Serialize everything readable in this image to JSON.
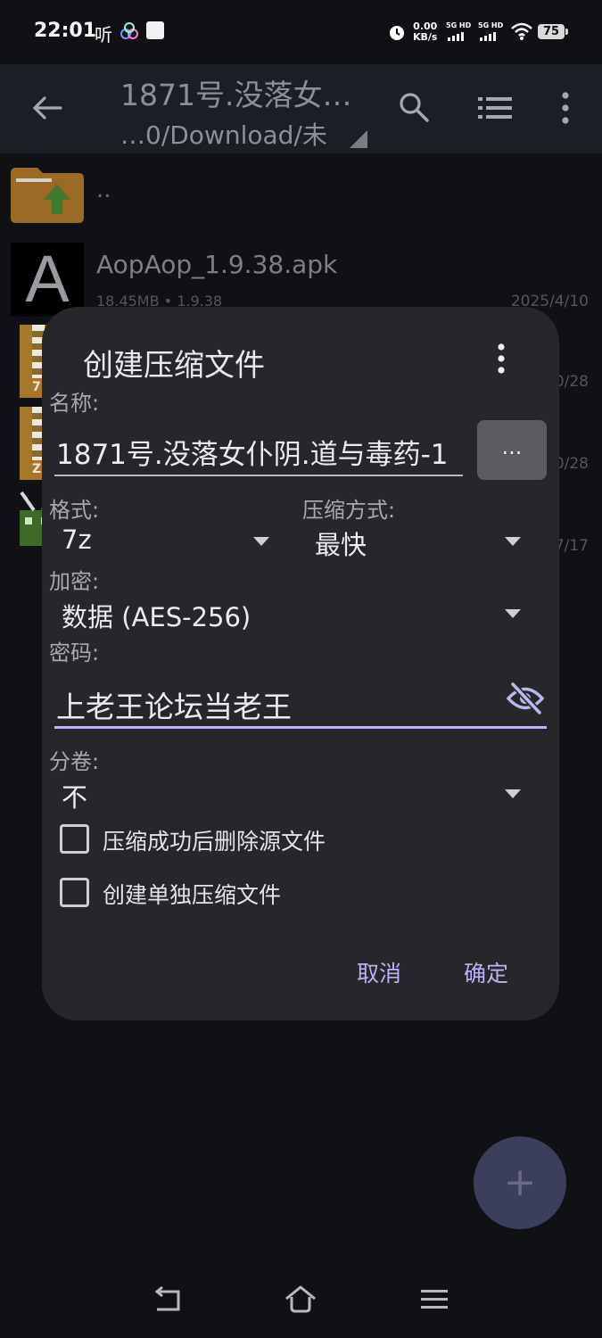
{
  "status_bar": {
    "time": "22:01",
    "ting": "听",
    "speed_top": "0.00",
    "speed_unit": "KB/s",
    "sig1": "5G HD",
    "sig2": "5G HD",
    "battery": "75"
  },
  "app_bar": {
    "title": "1871号.没落女…",
    "subtitle": "…0/Download/未"
  },
  "files": [
    {
      "name": ".."
    },
    {
      "name": "AopAop_1.9.38.apk",
      "meta": "18.45MB   • 1.9.38",
      "date": "2025/4/10",
      "icon_letter": "A"
    },
    {
      "date": "0/28",
      "icon_letter": "7"
    },
    {
      "date": "0/28",
      "icon_letter": "Z"
    },
    {
      "date": "7/17"
    }
  ],
  "dialog": {
    "title": "创建压缩文件",
    "name_label": "名称:",
    "name_value": "1871号.没落女仆阴.道与毒药-1",
    "browse_label": "...",
    "format_label": "格式:",
    "format_value": "7z",
    "method_label": "压缩方式:",
    "method_value": "最快",
    "encryption_label": "加密:",
    "encryption_value": "数据 (AES-256)",
    "password_label": "密码:",
    "password_value": "上老王论坛当老王",
    "split_label": "分卷:",
    "split_value": "不",
    "delete_source_label": "压缩成功后删除源文件",
    "separate_archive_label": "创建单独压缩文件",
    "cancel_label": "取消",
    "ok_label": "确定"
  },
  "colors": {
    "accent": "#b6b4f2",
    "dialog_bg": "#26262b",
    "page_bg": "#0f1115",
    "appbar_bg": "#1c1e25"
  },
  "icons": {
    "fab": "plus-icon"
  }
}
